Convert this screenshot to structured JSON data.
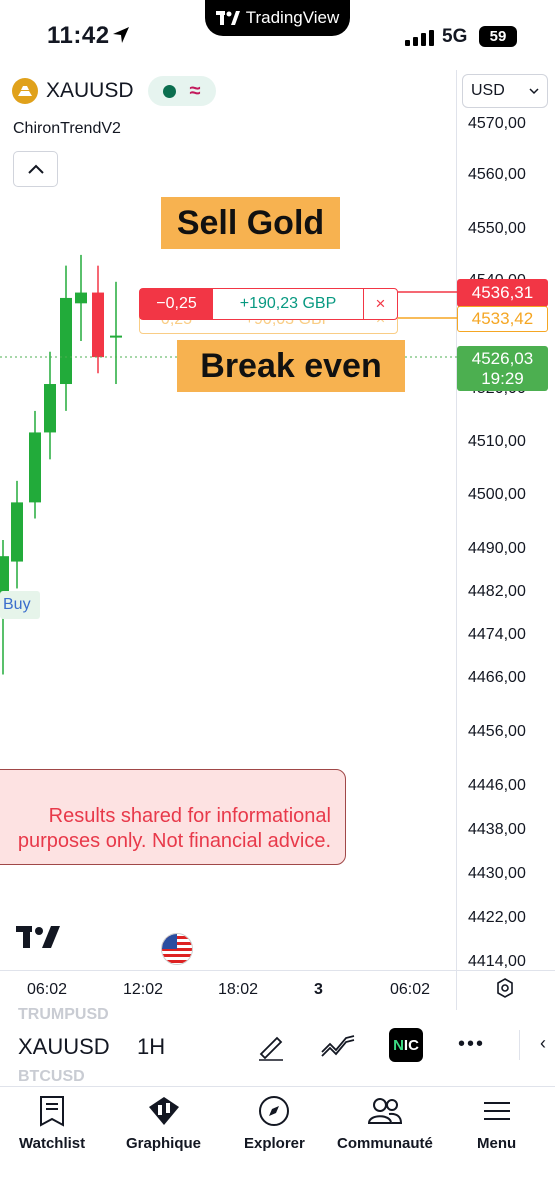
{
  "status_bar": {
    "time": "11:42",
    "network": "5G",
    "battery": "59",
    "brand": "TradingView"
  },
  "header": {
    "symbol": "XAUUSD",
    "indicator": "ChironTrendV2",
    "currency": "USD"
  },
  "price_scale": [
    "4570,00",
    "4560,00",
    "4550,00",
    "4540,00",
    "4520,00",
    "4510,00",
    "4500,00",
    "4490,00",
    "4482,00",
    "4474,00",
    "4466,00",
    "4456,00",
    "4446,00",
    "4438,00",
    "4430,00",
    "4422,00",
    "4414,00"
  ],
  "annotations": {
    "sell": "Sell Gold",
    "break_even": "Break even",
    "buy": "Buy"
  },
  "order": {
    "qty": "−0,25",
    "pnl": "+190,23 GBP",
    "close": "×",
    "ghost_qty": "0,25",
    "ghost_pnl": "+90,03 GBP"
  },
  "price_tags": {
    "entry": "4536,31",
    "break_even": "4533,42",
    "last": "4526,03",
    "countdown": "19:29"
  },
  "disclaimer": {
    "line1": "Results shared for informational",
    "line2": "purposes only. Not financial advice."
  },
  "time_axis": [
    "06:02",
    "12:02",
    "18:02",
    "3",
    "06:02"
  ],
  "toolbar": {
    "symbol": "XAUUSD",
    "interval": "1H",
    "ghost_above": "TRUMPUSD",
    "ghost_below": "BTCUSD",
    "nic": "NIC"
  },
  "nav": [
    {
      "label": "Watchlist",
      "icon": "watchlist-icon"
    },
    {
      "label": "Graphique",
      "icon": "chart-icon"
    },
    {
      "label": "Explorer",
      "icon": "compass-icon"
    },
    {
      "label": "Communauté",
      "icon": "community-icon"
    },
    {
      "label": "Menu",
      "icon": "menu-icon"
    }
  ],
  "colors": {
    "up": "#22ab3a",
    "down": "#f23645",
    "accent_orange": "#f7b250",
    "last_price": "#4caf50"
  },
  "candles": [
    {
      "o": 4478,
      "h": 4486,
      "l": 4470,
      "c": 4489
    },
    {
      "o": 4488,
      "h": 4500,
      "l": 4486,
      "c": 4499
    },
    {
      "o": 4499,
      "h": 4513,
      "l": 4499,
      "c": 4512
    },
    {
      "o": 4512,
      "h": 4524,
      "l": 4510,
      "c": 4521
    },
    {
      "o": 4521,
      "h": 4540,
      "l": 4519,
      "c": 4537
    },
    {
      "o": 4536,
      "h": 4542,
      "l": 4532,
      "c": 4538
    },
    {
      "o": 4538,
      "h": 4540,
      "l": 4528,
      "c": 4526
    },
    {
      "o": 4530,
      "h": 4537,
      "l": 4524,
      "c": 4530
    }
  ]
}
